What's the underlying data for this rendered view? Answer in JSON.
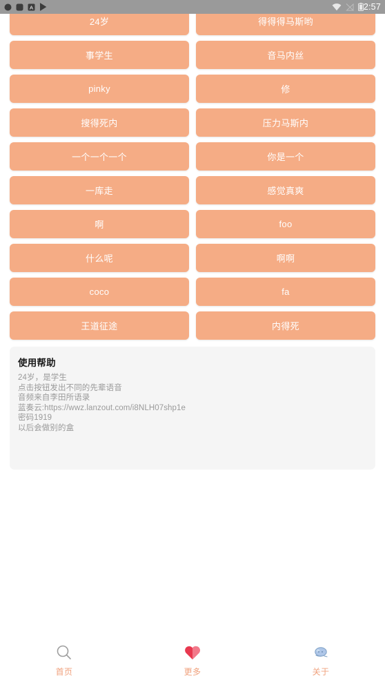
{
  "status_bar": {
    "clock": "2:57",
    "background_color": "#9a9a9a",
    "left_icons": [
      {
        "name": "notification-circle-icon",
        "glyph": "●"
      },
      {
        "name": "notification-square-icon",
        "glyph": "■"
      },
      {
        "name": "app-letter-a-icon",
        "glyph": "A"
      },
      {
        "name": "play-store-icon",
        "glyph": "▶"
      }
    ],
    "right_icons": [
      {
        "name": "wifi-icon",
        "glyph": "▼"
      },
      {
        "name": "signal-off-icon",
        "glyph": "◺"
      },
      {
        "name": "battery-icon",
        "glyph": "▮"
      }
    ]
  },
  "theme": {
    "button_color": "#f5ac85",
    "button_text_color": "#ffffff",
    "nav_label_color": "#f0a27e",
    "card_background": "#f5f5f5",
    "page_background": "#ffffff",
    "heart_color": "#e8384f"
  },
  "soundboard": {
    "buttons": [
      "24岁",
      "得得得马斯哟",
      "事学生",
      "音马内丝",
      "pinky",
      "修",
      "搜得死内",
      "压力马斯内",
      "一个一个一个",
      "你是一个",
      "一库走",
      "感觉真爽",
      "啊",
      "foo",
      "什么呢",
      "啊啊",
      "coco",
      "fa",
      "王道征途",
      "内得死"
    ]
  },
  "help": {
    "title": "使用帮助",
    "lines": [
      "24岁，是学生",
      "点击按钮发出不同的先辈语音",
      "音频来自李田所语录",
      "蓝奏云:https://wwz.lanzout.com/i8NLH07shp1e",
      "密码1919",
      "以后会做别的盒"
    ]
  },
  "bottom_nav": {
    "items": [
      {
        "label": "首页",
        "icon": "search-icon"
      },
      {
        "label": "更多",
        "icon": "heart-icon"
      },
      {
        "label": "关于",
        "icon": "cloud-icon"
      }
    ]
  }
}
